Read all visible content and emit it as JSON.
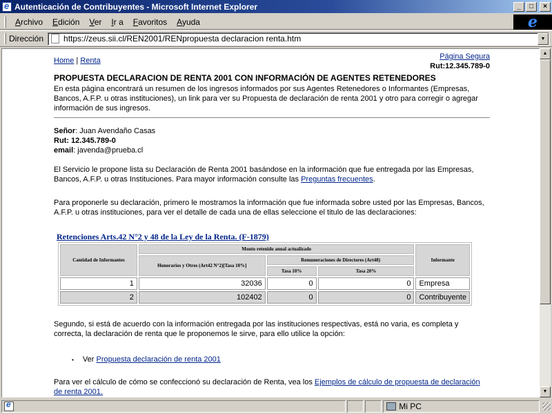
{
  "window": {
    "title": "Autenticación de Contribuyentes - Microsoft Internet Explorer",
    "minimize": "_",
    "maximize": "□",
    "close": "×"
  },
  "menu": {
    "items": [
      {
        "label": "Archivo",
        "accel": "A",
        "rest": "rchivo"
      },
      {
        "label": "Edición",
        "accel": "E",
        "rest": "dición"
      },
      {
        "label": "Ver",
        "accel": "V",
        "rest": "er"
      },
      {
        "label": "Ir a",
        "accel": "I",
        "rest": "r a"
      },
      {
        "label": "Favoritos",
        "accel": "F",
        "rest": "avoritos"
      },
      {
        "label": "Ayuda",
        "accel": "A",
        "rest": "yuda"
      }
    ]
  },
  "address": {
    "label": "Dirección",
    "url": "https://zeus.sii.cl/REN2001/RENpropuesta declaracion renta.htm"
  },
  "page": {
    "links": {
      "home": "Home",
      "separator": "|",
      "renta": "Renta"
    },
    "secure_link": "Página Segura",
    "rut_top": "Rut:12.345.789-0",
    "heading": "PROPUESTA DECLARACION DE RENTA 2001 CON INFORMACIÓN DE AGENTES RETENEDORES",
    "intro": "En esta página encontrará un resumen de los ingresos informados por sus Agentes Retenedores o Informantes (Empresas, Bancos, A.F.P. u otras instituciones), un link para ver su Propuesta de declaración de renta 2001 y otro para corregir o agregar información de sus ingresos.",
    "user": {
      "senor_label": "Señor",
      "senor_value": ": Juan Avendaño Casas",
      "rut_label": "Rut",
      "rut_value": ": 12.345.789-0",
      "email_label": "email",
      "email_value": ": javenda@prueba.cl"
    },
    "para1_text": "El Servicio le propone lista su Declaración de Renta 2001 basándose en la información que fue entregada por las Empresas, Bancos, A.F.P. u otras Instituciones. Para mayor información consulte las ",
    "para1_link": "Preguntas frecuentes",
    "para1_end": ".",
    "para2": "Para proponerle su declaración, primero le mostramos la información que fue informada sobre usted por las Empresas, Bancos, A.F.P. u otras instituciones, para ver el detalle de cada una de ellas seleccione el titulo de las declaraciones:",
    "retenciones": {
      "title": "Retenciones Arts.42 N°2 y 48 de la Ley de la Renta. (F-1879)",
      "headers": {
        "cantidad": "Cantidad de Informantes",
        "monto": "Monto retenido anual actualizado",
        "honorarios": "Honorarios y Otros (Art42 N°2)[Tasa 10%]",
        "remuneraciones": "Remuneraciones de Directores (Art48)",
        "tasa10": "Tasa 10%",
        "tasa20": "Tasa 20%",
        "informante": "Informante"
      },
      "rows": [
        {
          "cantidad": "1",
          "honorarios": "32036",
          "tasa10": "0",
          "tasa20": "0",
          "informante": "Empresa"
        },
        {
          "cantidad": "2",
          "honorarios": "102402",
          "tasa10": "0",
          "tasa20": "0",
          "informante": "Contribuyente"
        }
      ]
    },
    "para3": "Segundo, si está de acuerdo con la información entregada por las instituciones respectivas, está no varia, es completa y correcta, la declaración de renta que le proponemos le sirve, para ello utilice la opción:",
    "bullet_prefix": "Ver ",
    "bullet_link": "Propuesta declaración de renta 2001",
    "para4_text": "Para ver el cálculo de cómo se confeccionó su declaración de Renta, vea los ",
    "para4_link": "Ejemplos de cálculo de propuesta de declaración de renta 2001."
  },
  "status": {
    "zone": "Mi PC"
  }
}
